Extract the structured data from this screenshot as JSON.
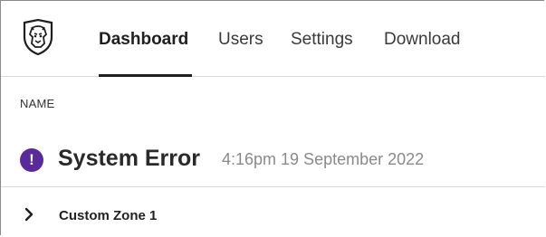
{
  "header": {
    "logo_icon": "lion-shield-icon",
    "tabs": [
      {
        "label": "Dashboard",
        "active": true
      },
      {
        "label": "Users",
        "active": false
      },
      {
        "label": "Settings",
        "active": false
      },
      {
        "label": "Download",
        "active": false
      }
    ]
  },
  "table": {
    "column_header": "NAME",
    "error": {
      "status_icon": "exclamation-circle-icon",
      "status_symbol": "!",
      "status_color": "#5b2a9a",
      "title": "System Error",
      "timestamp": "4:16pm 19 September 2022"
    },
    "rows": [
      {
        "expand_icon": "chevron-right-icon",
        "label": "Custom Zone 1"
      }
    ]
  }
}
